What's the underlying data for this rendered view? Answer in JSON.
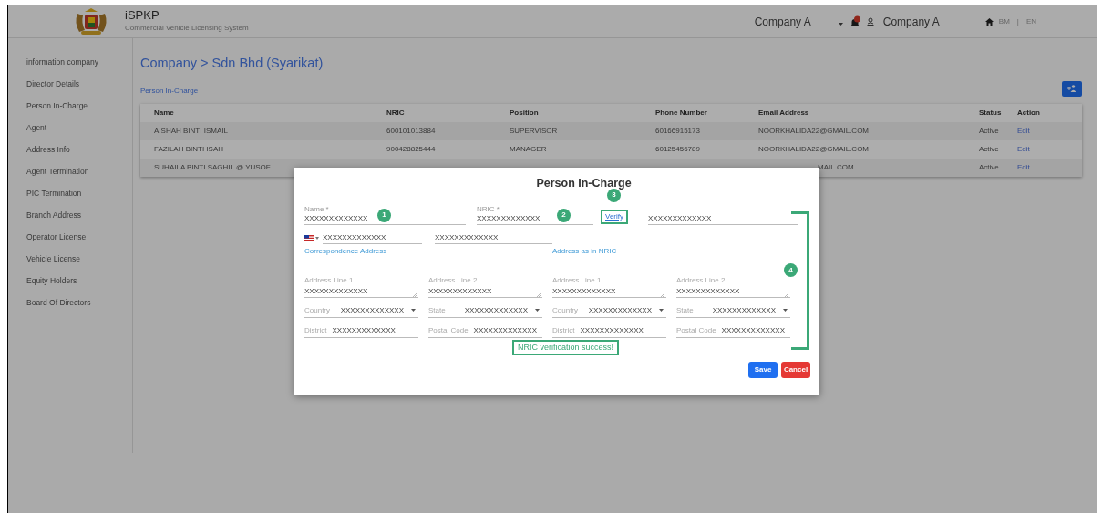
{
  "header": {
    "app_title": "iSPKP",
    "app_subtitle": "Commercial Vehicle Licensing System",
    "company": "Company A",
    "user_name": "Company A",
    "languages": [
      "BM",
      "EN"
    ],
    "language_separator": "|"
  },
  "sidebar": {
    "items": [
      {
        "label": "information company"
      },
      {
        "label": "Director Details"
      },
      {
        "label": "Person In-Charge"
      },
      {
        "label": "Agent"
      },
      {
        "label": "Address Info"
      },
      {
        "label": "Agent Termination"
      },
      {
        "label": "PIC Termination"
      },
      {
        "label": "Branch Address"
      },
      {
        "label": "Operator License"
      },
      {
        "label": "Vehicle License"
      },
      {
        "label": "Equity Holders"
      },
      {
        "label": "Board Of Directors"
      }
    ]
  },
  "breadcrumb": "Company > Sdn Bhd (Syarikat)",
  "section_link": "Person In-Charge",
  "table": {
    "columns": [
      "Name",
      "NRIC",
      "Position",
      "Phone Number",
      "Email Address",
      "Status",
      "Action"
    ],
    "rows": [
      {
        "cells": [
          "AISHAH BINTI ISMAIL",
          "600101013884",
          "SUPERVISOR",
          "60166915173",
          "NOORKHALIDA22@GMAIL.COM",
          "Active",
          "Edit"
        ]
      },
      {
        "cells": [
          "FAZILAH BINTI ISAH",
          "900428825444",
          "MANAGER",
          "60125456789",
          "NOORKHALIDA22@GMAIL.COM",
          "Active",
          "Edit"
        ]
      },
      {
        "cells": [
          "SUHAILA BINTI SAGHIL @ YUSOF",
          null,
          null,
          null,
          "MAIL.COM",
          "Active",
          "Edit"
        ]
      }
    ]
  },
  "modal": {
    "title": "Person In-Charge",
    "identity": [
      {
        "kind": "text",
        "label": "Name *",
        "value": "XXXXXXXXXXXXX",
        "marker": "1"
      },
      {
        "kind": "text",
        "label": "NRIC *",
        "value": "XXXXXXXXXXXXX",
        "marker": "2"
      },
      {
        "kind": "verify",
        "label": "Verify",
        "marker": "3"
      },
      {
        "kind": "text",
        "value": "XXXXXXXXXXXXX"
      }
    ],
    "contact": [
      {
        "kind": "phone",
        "value": "XXXXXXXXXXXXX"
      },
      {
        "kind": "text",
        "value": "XXXXXXXXXXXXX"
      }
    ],
    "addresses": [
      {
        "heading": "Correspondence Address",
        "rows": [
          [
            {
              "kind": "textarea",
              "label": "Address Line 1",
              "value": "XXXXXXXXXXXXX"
            },
            {
              "kind": "textarea",
              "label": "Address Line 2",
              "value": "XXXXXXXXXXXXX"
            }
          ],
          [
            {
              "kind": "select",
              "label": "Country",
              "value": "XXXXXXXXXXXXX"
            },
            {
              "kind": "select",
              "label": "State",
              "value": "XXXXXXXXXXXXX"
            }
          ],
          [
            {
              "kind": "inline",
              "label": "District",
              "value": "XXXXXXXXXXXXX"
            },
            {
              "kind": "inline",
              "label": "Postal Code",
              "value": "XXXXXXXXXXXXX"
            }
          ]
        ]
      },
      {
        "heading": "Address as in NRIC",
        "rows": [
          [
            {
              "kind": "textarea",
              "label": "Address Line 1",
              "value": "XXXXXXXXXXXXX"
            },
            {
              "kind": "textarea",
              "label": "Address Line 2",
              "value": "XXXXXXXXXXXXX"
            }
          ],
          [
            {
              "kind": "select",
              "label": "Country",
              "value": "XXXXXXXXXXXXX"
            },
            {
              "kind": "select",
              "label": "State",
              "value": "XXXXXXXXXXXXX"
            }
          ],
          [
            {
              "kind": "inline",
              "label": "District",
              "value": "XXXXXXXXXXXXX"
            },
            {
              "kind": "inline",
              "label": "Postal Code",
              "value": "XXXXXXXXXXXXX"
            }
          ]
        ]
      }
    ],
    "group_marker": "4",
    "message": "NRIC verification success!",
    "buttons": [
      {
        "kind": "primary",
        "label": "Save"
      },
      {
        "kind": "danger",
        "label": "Cancel"
      }
    ]
  }
}
